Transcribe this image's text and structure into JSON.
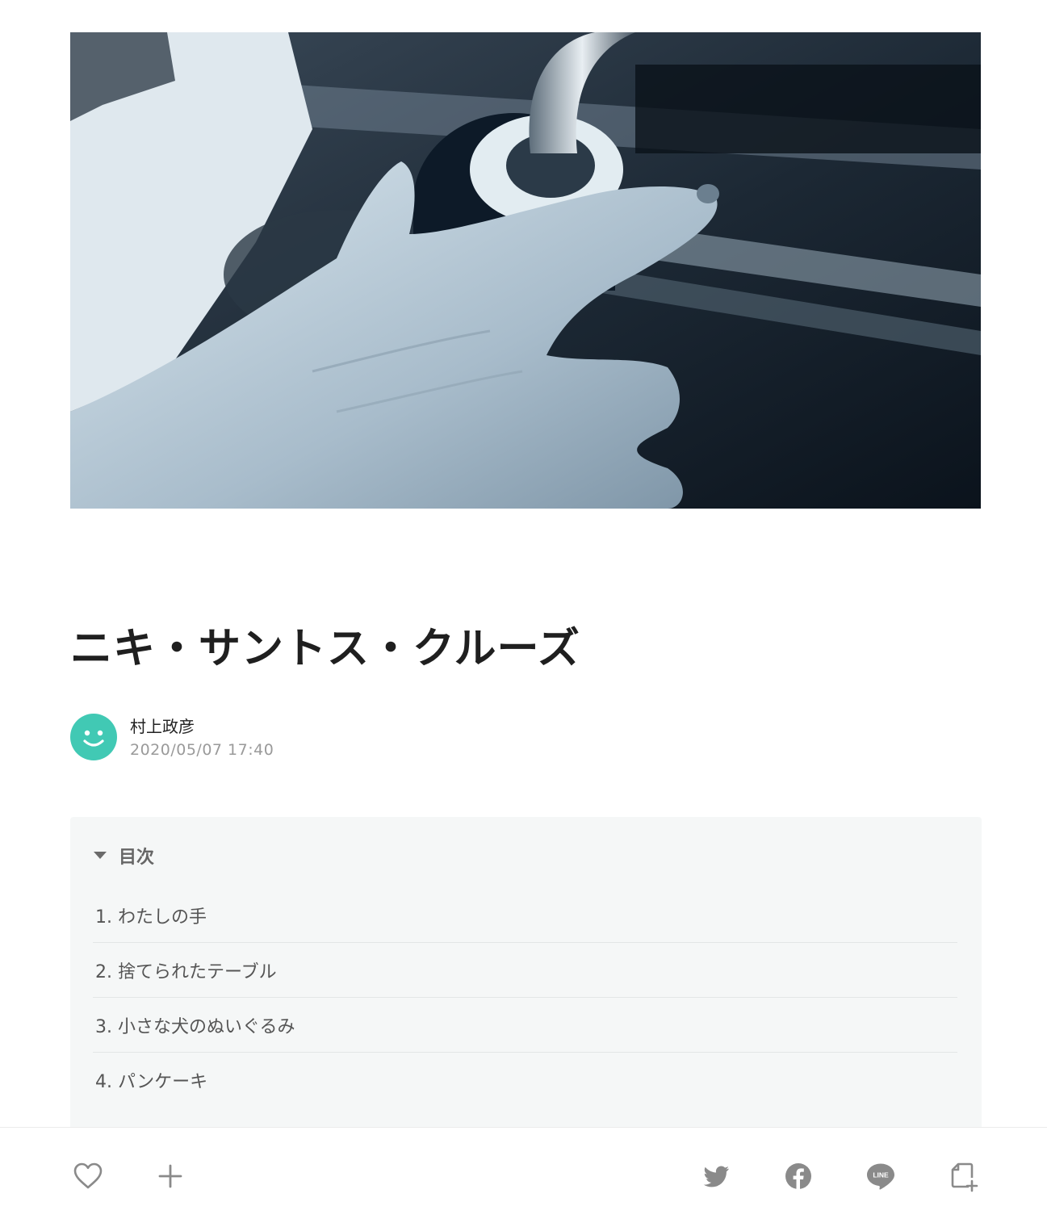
{
  "article": {
    "title": "ニキ・サントス・クルーズ",
    "author_name": "村上政彦",
    "published_at": "2020/05/07 17:40"
  },
  "toc": {
    "heading": "目次",
    "items": [
      "1.  わたしの手",
      "2. 捨てられたテーブル",
      "3. 小さな犬のぬいぐるみ",
      "4. パンケーキ"
    ]
  },
  "icons": {
    "like": "heart-icon",
    "add": "plus-icon",
    "share_twitter": "twitter-icon",
    "share_facebook": "facebook-icon",
    "share_line": "line-icon",
    "embed": "embed-icon"
  },
  "colors": {
    "avatar": "#41c9b4",
    "icon_gray": "#8a8a8a",
    "toc_background": "#f5f7f7"
  }
}
